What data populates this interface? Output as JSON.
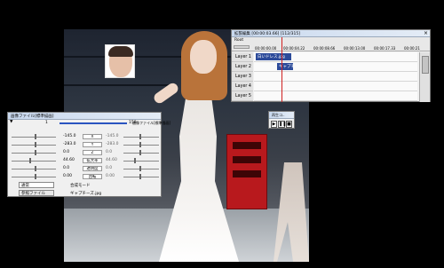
{
  "timeline": {
    "title": "拡張編集 [00:00:03.66] [112/315]",
    "root": "Root",
    "timecodes": [
      "00:00:00.00",
      "00:00:04.22",
      "00:00:08.66",
      "00:00:13.00",
      "00:00:17.33",
      "00:00:21"
    ],
    "layers": [
      "Layer 1",
      "Layer 2",
      "Layer 3",
      "Layer 4",
      "Layer 5"
    ],
    "clips": [
      {
        "layer": 1,
        "label": "白いドレス.jpg"
      },
      {
        "layer": 2,
        "label": "ギャプチ"
      }
    ],
    "close": "×"
  },
  "playctl": {
    "title": "再生コ..",
    "buttons": [
      "▶",
      "❚❚",
      "■"
    ]
  },
  "props": {
    "title": "画像ファイル[標準描画]",
    "frame_start": "1",
    "frame_end": "158",
    "toggle_label": "画像ファイル[標準描画]",
    "params": [
      {
        "left": "-145.0",
        "name": "X",
        "right": "-145.0"
      },
      {
        "left": "-283.0",
        "name": "Y",
        "right": "-283.0"
      },
      {
        "left": "0.0",
        "name": "Z",
        "right": "0.0"
      },
      {
        "left": "44.60",
        "name": "拡大率",
        "right": "44.60"
      },
      {
        "left": "0.0",
        "name": "透明度",
        "right": "0.0"
      },
      {
        "left": "0.00",
        "name": "回転",
        "right": "0.00"
      }
    ],
    "blend_mode": "通常",
    "blend_label": "合成モード",
    "ref_button": "参照ファイル",
    "file_name": "ギャプチーズ.jpg"
  }
}
